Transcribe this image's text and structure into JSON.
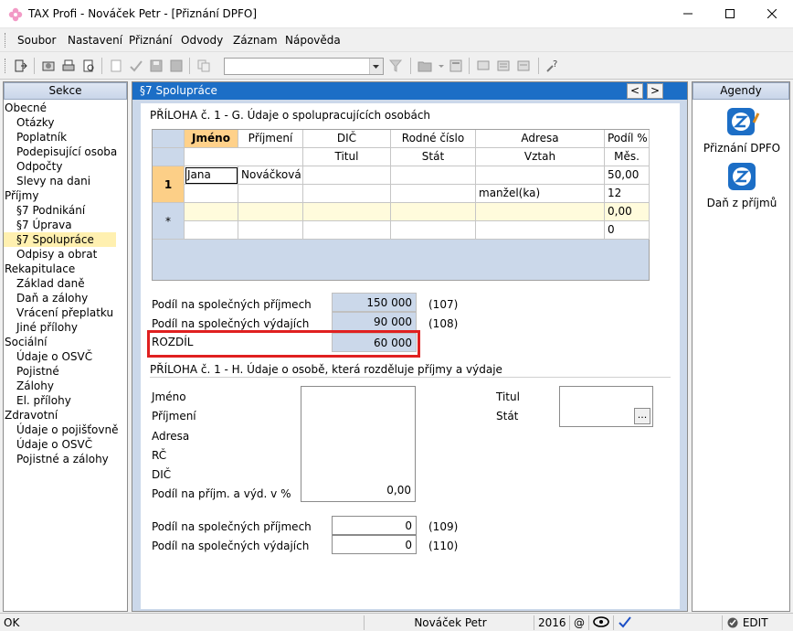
{
  "window": {
    "title": "TAX Profi - Nováček Petr - [Přiznání DPFO]"
  },
  "menu": [
    "Soubor",
    "Nastavení",
    "Přiznání",
    "Odvody",
    "Záznam",
    "Nápověda"
  ],
  "left_panel": {
    "header": "Sekce",
    "items": [
      {
        "label": "Obecné",
        "level": 0
      },
      {
        "label": "Otázky",
        "level": 1
      },
      {
        "label": "Poplatník",
        "level": 1
      },
      {
        "label": "Podepisující osoba",
        "level": 1
      },
      {
        "label": "Odpočty",
        "level": 1
      },
      {
        "label": "Slevy na dani",
        "level": 1
      },
      {
        "label": "Příjmy",
        "level": 0
      },
      {
        "label": "§7 Podnikání",
        "level": 1
      },
      {
        "label": "§7 Úprava",
        "level": 1
      },
      {
        "label": "§7 Spolupráce",
        "level": 1,
        "selected": true
      },
      {
        "label": "Odpisy a obrat",
        "level": 1
      },
      {
        "label": "Rekapitulace",
        "level": 0
      },
      {
        "label": "Základ daně",
        "level": 1
      },
      {
        "label": "Daň a zálohy",
        "level": 1
      },
      {
        "label": "Vrácení přeplatku",
        "level": 1
      },
      {
        "label": "Jiné přílohy",
        "level": 1
      },
      {
        "label": "Sociální",
        "level": 0
      },
      {
        "label": "Údaje o OSVČ",
        "level": 1
      },
      {
        "label": "Pojistné",
        "level": 1
      },
      {
        "label": "Zálohy",
        "level": 1
      },
      {
        "label": "El. přílohy",
        "level": 1
      },
      {
        "label": "Zdravotní",
        "level": 0
      },
      {
        "label": "Údaje o pojišťovně",
        "level": 1
      },
      {
        "label": "Údaje o OSVČ",
        "level": 1
      },
      {
        "label": "Pojistné a zálohy",
        "level": 1
      }
    ]
  },
  "center": {
    "header": "§7 Spolupráce",
    "nav_prev": "<",
    "nav_next": ">",
    "section_g": "PŘÍLOHA č. 1 - G. Údaje o spolupracujících osobách",
    "grid": {
      "headers1": [
        "Jméno",
        "Příjmení",
        "DIČ",
        "Rodné číslo",
        "Adresa",
        "Podíl %"
      ],
      "headers2": [
        "Titul",
        "Stát",
        "Vztah",
        "Měs."
      ],
      "row1": {
        "num": "1",
        "jmeno": "Jana",
        "prijmeni": "Nováčková",
        "podil": "50,00",
        "vztah": "manžel(ka)",
        "mes": "12"
      },
      "newrow": {
        "star": "*",
        "podil": "0,00",
        "mes": "0"
      }
    },
    "summary": [
      {
        "label": "Podíl na společných příjmech",
        "value": "150 000",
        "code": "(107)"
      },
      {
        "label": "Podíl na společných výdajích",
        "value": "90 000",
        "code": "(108)"
      },
      {
        "label": "ROZDÍL",
        "value": "60 000",
        "code": ""
      }
    ],
    "section_h": "PŘÍLOHA č. 1 - H. Údaje o osobě, která rozděluje příjmy a výdaje",
    "h_labels": [
      "Jméno",
      "Příjmení",
      "Adresa",
      "RČ",
      "DIČ",
      "Podíl na příjm. a výd. v %"
    ],
    "h_podil": "0,00",
    "h_right_labels": [
      "Titul",
      "Stát"
    ],
    "h_ellipsis": "...",
    "bottom": [
      {
        "label": "Podíl na společných příjmech",
        "value": "0",
        "code": "(109)"
      },
      {
        "label": "Podíl na společných výdajích",
        "value": "0",
        "code": "(110)"
      }
    ]
  },
  "right_panel": {
    "header": "Agendy",
    "items": [
      {
        "label": "Přiznání DPFO"
      },
      {
        "label": "Daň z příjmů"
      }
    ]
  },
  "status": {
    "left": "OK",
    "user": "Nováček Petr",
    "year": "2016",
    "at": "@",
    "mode": "EDIT"
  },
  "colors": {
    "accent": "#1c6ec6",
    "highlight": "#e02020",
    "selected_row": "#fccf87"
  }
}
